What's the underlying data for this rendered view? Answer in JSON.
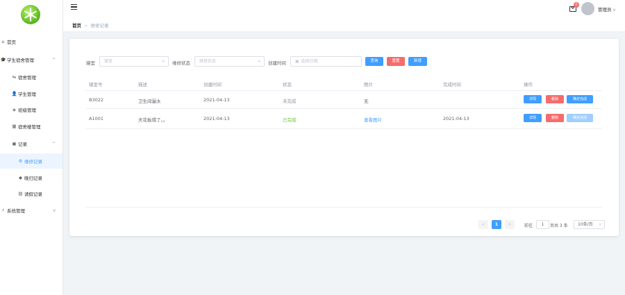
{
  "sidebar": {
    "menu": [
      {
        "icon": "home-icon",
        "glyph": "⌂",
        "label": "首页",
        "arrow": ""
      },
      {
        "icon": "graduation-cap-icon",
        "glyph": "🎓",
        "label": "学生宿舍管理",
        "arrow": "^"
      },
      {
        "icon": "swap-icon",
        "glyph": "⇆",
        "label": "宿舍管理",
        "arrow": ""
      },
      {
        "icon": "user-icon",
        "glyph": "👤",
        "label": "学生管理",
        "arrow": ""
      },
      {
        "icon": "class-icon",
        "glyph": "◈",
        "label": "班级管理",
        "arrow": ""
      },
      {
        "icon": "building-icon",
        "glyph": "▦",
        "label": "宿舍楼管理",
        "arrow": ""
      },
      {
        "icon": "calendar-icon",
        "glyph": "▣",
        "label": "记录",
        "arrow": "^"
      },
      {
        "icon": "repair-icon",
        "glyph": "⚙",
        "label": "维修记录",
        "arrow": ""
      },
      {
        "icon": "tag-icon",
        "glyph": "◆",
        "label": "晚归记录",
        "arrow": ""
      },
      {
        "icon": "document-icon",
        "glyph": "▤",
        "label": "请假记录",
        "arrow": ""
      },
      {
        "icon": "lightning-icon",
        "glyph": "⚡",
        "label": "系统管理",
        "arrow": "v"
      }
    ]
  },
  "header": {
    "breadcrumb_home": "首页",
    "breadcrumb_sep": ">",
    "breadcrumb_current": "维修记录",
    "notification_count": "0",
    "username": "管理员",
    "username_arrow": "v"
  },
  "filters": {
    "dorm_label": "寝室",
    "dorm_placeholder": "寝室",
    "status_label": "维修状态",
    "status_placeholder": "维修状态",
    "time_label": "创建时间",
    "time_placeholder": "选择日期",
    "chevron": "v",
    "query_button": "查询",
    "reset_button": "重置",
    "add_button": "新增"
  },
  "table": {
    "headers": [
      "寝室号",
      "描述",
      "创建时间",
      "状态",
      "图片",
      "完成时间",
      "操作"
    ],
    "rows": [
      {
        "room": "B3022",
        "desc": "卫生间漏水",
        "created": "2021-04-13",
        "status": "未完成",
        "image": "无",
        "finished": ""
      },
      {
        "room": "A1001",
        "desc": "天花板塌了。。",
        "created": "2021-04-13",
        "status": "已完成",
        "image": "查看图片",
        "finished": "2021-04-13"
      }
    ],
    "detail_button": "详情",
    "delete_button": "删除",
    "confirm_button": "确定完成"
  },
  "pagination": {
    "prev": "<",
    "page": "1",
    "next": ">",
    "goto_label": "前往",
    "goto_value": "1",
    "total_text": "页共 3 条",
    "page_size": "10条/页",
    "chevron": "v"
  },
  "colors": {
    "primary": "#409eff",
    "danger": "#f56c6c",
    "success": "#67c23a",
    "disabled_primary": "#a0cfff"
  }
}
